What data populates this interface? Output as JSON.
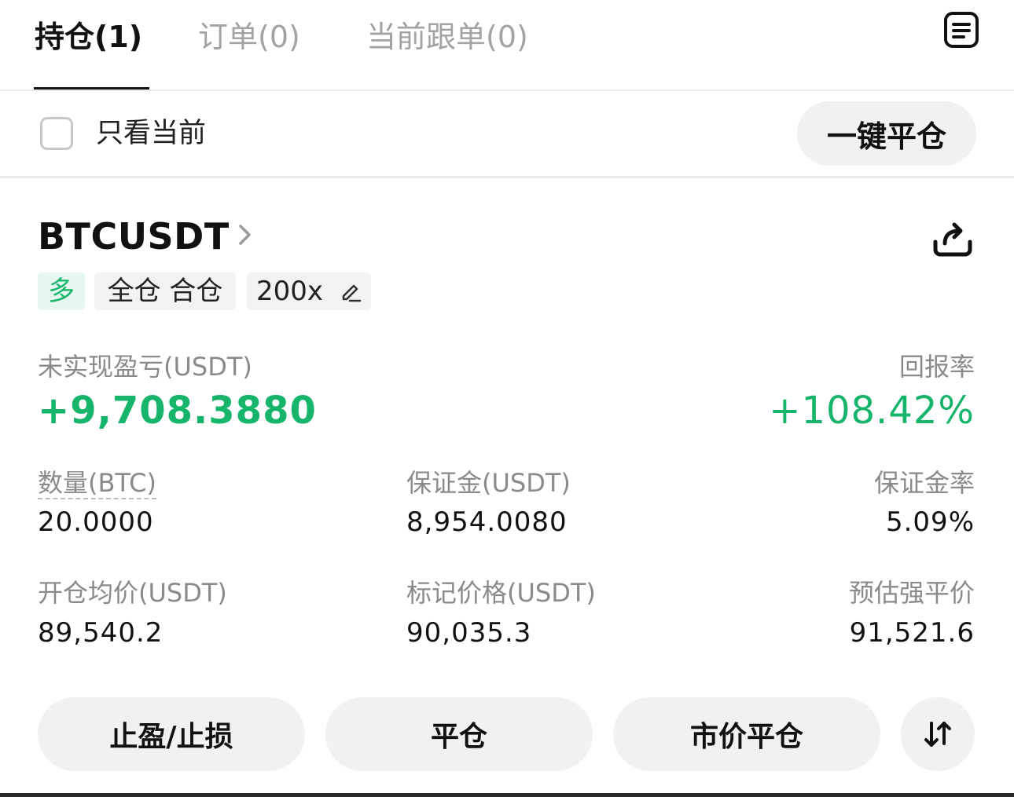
{
  "tabs": [
    {
      "label": "持仓(1)"
    },
    {
      "label": "订单(0)"
    },
    {
      "label": "当前跟单(0)"
    }
  ],
  "filter": {
    "checkbox_label": "只看当前",
    "close_all_label": "一键平仓"
  },
  "position": {
    "symbol": "BTCUSDT",
    "tags": {
      "side": "多",
      "margin_mode": "全仓 合仓",
      "leverage": "200x"
    },
    "pnl_label": "未实现盈亏(USDT)",
    "pnl_value": "+9,708.3880",
    "roe_label": "回报率",
    "roe_value": "+108.42%",
    "qty_label": "数量(BTC)",
    "qty_value": "20.0000",
    "margin_label": "保证金(USDT)",
    "margin_value": "8,954.0080",
    "margin_ratio_label": "保证金率",
    "margin_ratio_value": "5.09%",
    "entry_label": "开仓均价(USDT)",
    "entry_value": "89,540.2",
    "mark_label": "标记价格(USDT)",
    "mark_value": "90,035.3",
    "liq_label": "预估强平价",
    "liq_value": "91,521.6"
  },
  "actions": {
    "tp_sl": "止盈/止损",
    "close": "平仓",
    "market_close": "市价平仓"
  },
  "colors": {
    "profit_green": "#17b56b",
    "muted_text": "#8a8a8a",
    "button_bg": "#f1f1f1"
  },
  "icons": {
    "menu": "list-menu-icon",
    "share": "share-icon",
    "edit": "pencil-icon",
    "sort": "swap-vertical-icon",
    "chevron": "chevron-right-icon"
  }
}
